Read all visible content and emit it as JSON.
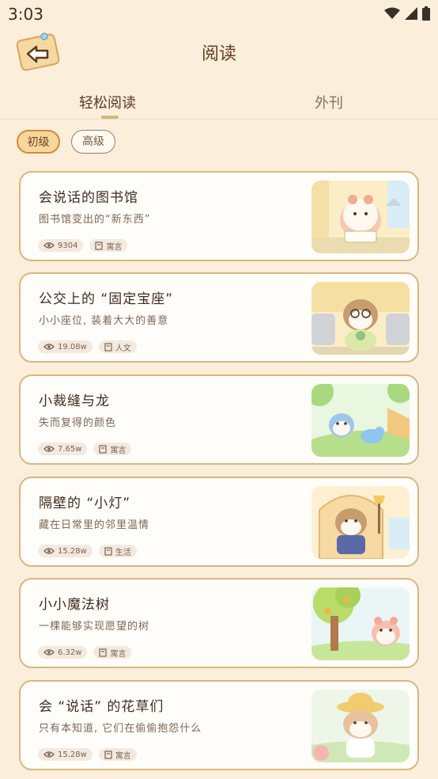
{
  "status_bar": {
    "time": "3:03"
  },
  "header": {
    "title": "阅读",
    "back_icon": "back-arrow-icon"
  },
  "tabs": [
    {
      "label": "轻松阅读",
      "active": true
    },
    {
      "label": "外刊",
      "active": false
    }
  ],
  "levels": [
    {
      "label": "初级",
      "selected": true
    },
    {
      "label": "高级",
      "selected": false
    }
  ],
  "articles": [
    {
      "title": "会说话的图书馆",
      "subtitle": "图书馆变出的“新东西”",
      "views": "9304",
      "category": "寓言",
      "thumb_icon": "hamster-reading-icon"
    },
    {
      "title": "公交上的 “固定宝座”",
      "subtitle": "小小座位, 装着大大的善意",
      "views": "19.08w",
      "category": "人文",
      "thumb_icon": "hamster-bus-seat-icon"
    },
    {
      "title": "小裁缝与龙",
      "subtitle": "失而复得的颜色",
      "views": "7.65w",
      "category": "寓言",
      "thumb_icon": "tailor-dragon-icon"
    },
    {
      "title": "隔壁的 “小灯”",
      "subtitle": "藏在日常里的邻里温情",
      "views": "15.28w",
      "category": "生活",
      "thumb_icon": "hamster-lamp-icon"
    },
    {
      "title": "小小魔法树",
      "subtitle": "一棵能够实现愿望的树",
      "views": "6.32w",
      "category": "寓言",
      "thumb_icon": "magic-tree-icon"
    },
    {
      "title": "会 “说话” 的花草们",
      "subtitle": "只有本知道, 它们在偷偷抱怨什么",
      "views": "15.28w",
      "category": "寓言",
      "thumb_icon": "hamster-gardener-icon"
    }
  ],
  "colors": {
    "background": "#fbefdc",
    "card_border": "#d9b780",
    "chip_active": "#f7d79b",
    "title_brown": "#6b3e1e"
  }
}
